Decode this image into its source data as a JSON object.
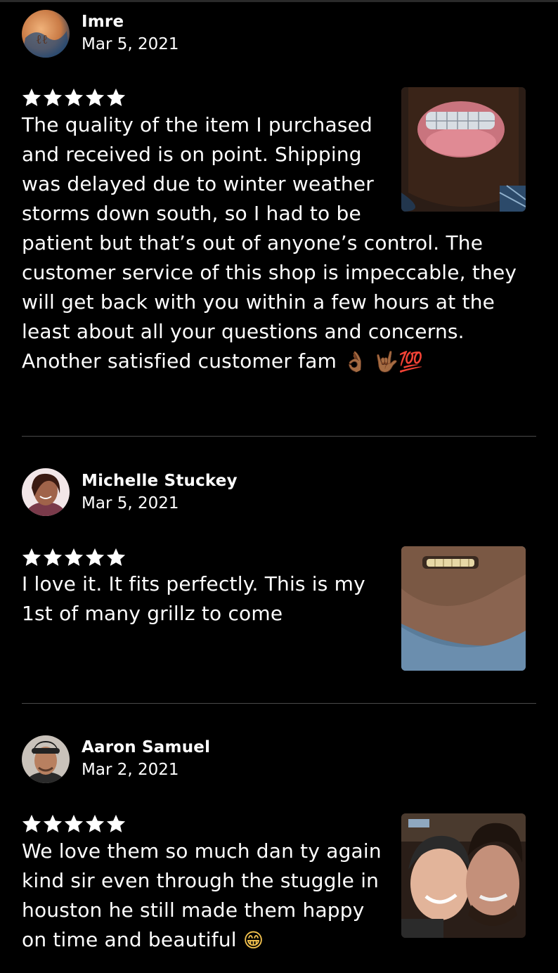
{
  "reviews": [
    {
      "name": "Imre",
      "date": "Mar 5, 2021",
      "rating": 5,
      "text": "The quality of the item I purchased and received is on point. Shipping was delayed due to winter weather storms down south, so I had to be patient but that’s out of anyone’s control. The customer service of this shop is impeccable, they will get back with you within a few hours at the least about all your questions and concerns. Another satisfied customer fam",
      "emoji_trail": "👌🏾 🤟🏾💯"
    },
    {
      "name": "Michelle Stuckey",
      "date": "Mar 5, 2021",
      "rating": 5,
      "text": "I love it. It fits perfectly. This is my 1st of many grillz to come",
      "emoji_trail": ""
    },
    {
      "name": "Aaron Samuel",
      "date": "Mar 2, 2021",
      "rating": 5,
      "text": "We love them so much dan ty again kind sir even through the stuggle in houston he still made them happy on time and beautiful",
      "emoji_trail": "😁"
    }
  ],
  "icons": {
    "star": "star-icon",
    "avatar": "avatar",
    "photo": "review-photo"
  },
  "colors": {
    "background": "#000000",
    "text": "#ffffff",
    "divider": "#4a4a4a"
  }
}
